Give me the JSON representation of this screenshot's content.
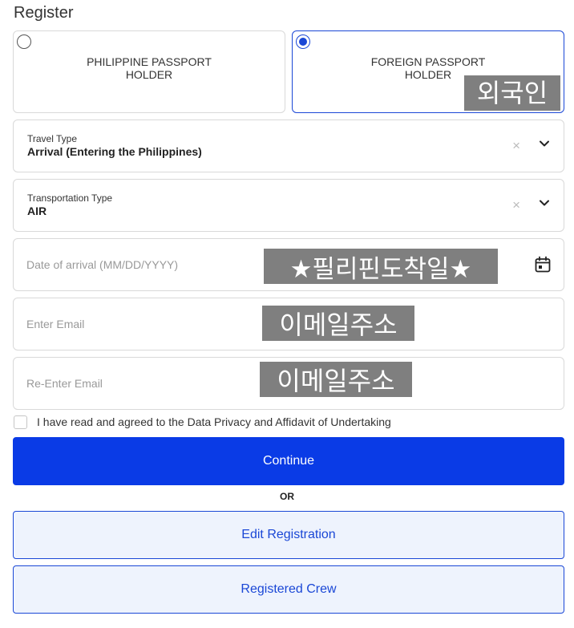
{
  "page": {
    "title": "Register"
  },
  "passport_options": [
    {
      "line1": "PHILIPPINE PASSPORT",
      "line2": "HOLDER",
      "selected": false
    },
    {
      "line1": "FOREIGN PASSPORT",
      "line2": "HOLDER",
      "selected": true,
      "overlay": "외국인"
    }
  ],
  "travel_type": {
    "label": "Travel Type",
    "value": "Arrival (Entering the Philippines)",
    "clear": "×"
  },
  "transportation_type": {
    "label": "Transportation Type",
    "value": "AIR",
    "clear": "×"
  },
  "date_of_arrival": {
    "placeholder": "Date of arrival (MM/DD/YYYY)",
    "overlay": "★필리핀도착일★"
  },
  "email": {
    "placeholder": "Enter Email",
    "overlay": "이메일주소"
  },
  "email_confirm": {
    "placeholder": "Re-Enter Email",
    "overlay": "이메일주소"
  },
  "agreement": {
    "label": "I have read and agreed to the Data Privacy and Affidavit of Undertaking",
    "checked": false
  },
  "buttons": {
    "continue": "Continue",
    "or": "OR",
    "edit_registration": "Edit Registration",
    "registered_crew": "Registered Crew"
  },
  "colors": {
    "primary": "#0a3be6",
    "outline_bg": "#eef3fd",
    "overlay_bg": "#7f7f7f"
  },
  "icons": {
    "dropdown": "chevron-down-icon",
    "calendar": "calendar-icon",
    "clear": "clear-icon"
  }
}
